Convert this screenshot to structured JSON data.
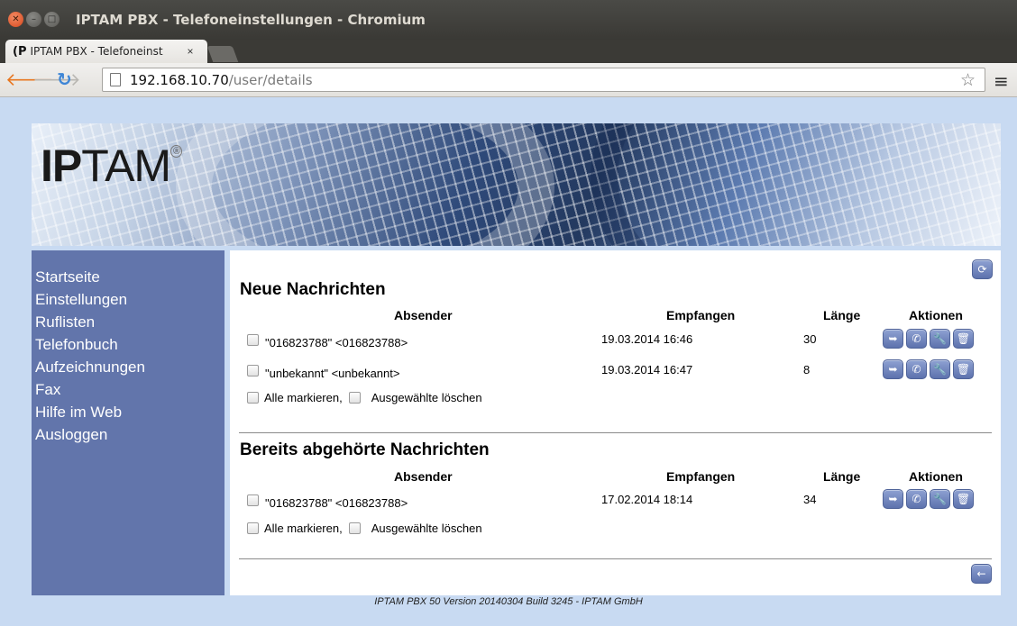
{
  "window": {
    "title": "IPTAM PBX - Telefoneinstellungen - Chromium"
  },
  "tab": {
    "label": "IPTAM PBX - Telefoneinst",
    "favicon": "iptam-favicon-icon"
  },
  "address_bar": {
    "host": "192.168.10.70",
    "path": "/user/details"
  },
  "logo": {
    "bold": "IP",
    "rest": "TAM",
    "mark": "®"
  },
  "sidebar": {
    "items": [
      {
        "label": "Startseite"
      },
      {
        "label": "Einstellungen"
      },
      {
        "label": "Ruflisten"
      },
      {
        "label": "Telefonbuch"
      },
      {
        "label": "Aufzeichnungen"
      },
      {
        "label": "Fax"
      },
      {
        "label": "Hilfe im Web"
      },
      {
        "label": "Ausloggen"
      }
    ]
  },
  "columns": {
    "sender": "Absender",
    "received": "Empfangen",
    "length": "Länge",
    "actions": "Aktionen"
  },
  "new_messages": {
    "title": "Neue Nachrichten",
    "rows": [
      {
        "sender": "\"016823788\" <016823788>",
        "received": "19.03.2014 16:46",
        "length": "30"
      },
      {
        "sender": "\"unbekannt\" <unbekannt>",
        "received": "19.03.2014 16:47",
        "length": "8"
      }
    ]
  },
  "old_messages": {
    "title": "Bereits abgehörte Nachrichten",
    "rows": [
      {
        "sender": "\"016823788\" <016823788>",
        "received": "17.02.2014 18:14",
        "length": "34"
      }
    ]
  },
  "select": {
    "mark_all": "Alle markieren,",
    "delete_selected": "Ausgewählte löschen"
  },
  "footer": {
    "text": "IPTAM PBX 50 Version 20140304 Build 3245 - IPTAM GmbH"
  },
  "icons": {
    "action_buttons": [
      "forward-icon",
      "call-icon",
      "settings-wrench-icon",
      "trash-icon"
    ],
    "refresh": "refresh-icon",
    "back": "back-arrow-icon"
  }
}
